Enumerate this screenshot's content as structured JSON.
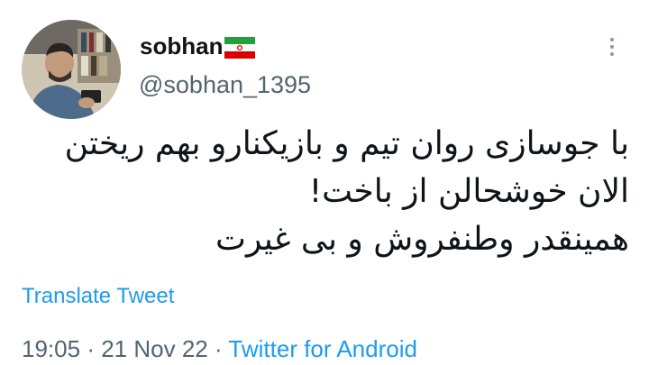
{
  "tweet": {
    "author": {
      "name": "sobhan",
      "flag_icon": "iran-flag-icon",
      "handle": "@sobhan_1395",
      "avatar_icon": "profile-photo-avatar"
    },
    "more_icon": "more-vertical-icon",
    "text_lines": [
      "با جوسازی روان تیم و بازیکنارو بهم ریختن",
      "الان خوشحالن از باخت!",
      "همینقدر وطنفروش و بی غیرت"
    ],
    "translate_label": "Translate Tweet",
    "time": "19:05",
    "separator": "·",
    "date": "21 Nov 22",
    "source": "Twitter for Android"
  },
  "colors": {
    "link": "#1d9bf0",
    "secondary_text": "#536471",
    "primary_text": "#0f1419",
    "flag_green": "#239f40",
    "flag_red": "#da0000"
  }
}
